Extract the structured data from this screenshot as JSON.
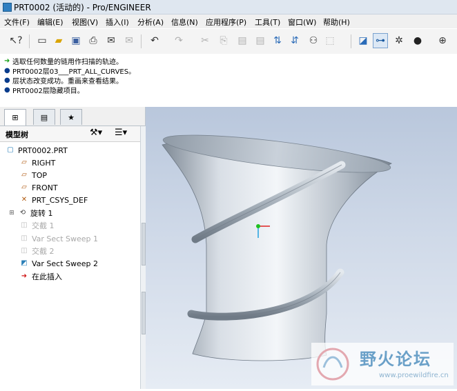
{
  "window": {
    "title": "PRT0002 (活动的) - Pro/ENGINEER"
  },
  "menu": {
    "items": [
      "文件(F)",
      "编辑(E)",
      "视图(V)",
      "插入(I)",
      "分析(A)",
      "信息(N)",
      "应用程序(P)",
      "工具(T)",
      "窗口(W)",
      "帮助(H)"
    ]
  },
  "toolbar": {
    "buttons": [
      {
        "name": "context-help-icon",
        "glyph": "↖?"
      },
      {
        "name": "new-file-icon",
        "glyph": "🗋"
      },
      {
        "name": "open-folder-icon",
        "glyph": "📂"
      },
      {
        "name": "save-icon",
        "glyph": "💾"
      },
      {
        "name": "print-icon",
        "glyph": "🖶"
      },
      {
        "name": "send-mail-icon",
        "glyph": "✉"
      },
      {
        "name": "send-link-icon",
        "glyph": "✉"
      },
      {
        "name": "undo-icon",
        "glyph": "↶"
      },
      {
        "name": "redo-icon",
        "glyph": "↷"
      },
      {
        "name": "cut-icon",
        "glyph": "✂"
      },
      {
        "name": "copy-icon",
        "glyph": "⎘"
      },
      {
        "name": "paste-icon",
        "glyph": "📋"
      },
      {
        "name": "paste-special-icon",
        "glyph": "📋"
      },
      {
        "name": "regenerate-icon",
        "glyph": "⇅"
      },
      {
        "name": "regen-manager-icon",
        "glyph": "⇅"
      },
      {
        "name": "find-icon",
        "glyph": "🔭"
      },
      {
        "name": "select-box-icon",
        "glyph": "⬚"
      },
      {
        "name": "repaint-icon",
        "glyph": "◪"
      },
      {
        "name": "spin-center-icon",
        "glyph": "⊶"
      },
      {
        "name": "orient-mode-icon",
        "glyph": "✲"
      },
      {
        "name": "shading-icon",
        "glyph": "●"
      },
      {
        "name": "zoom-in-icon",
        "glyph": "🔍"
      },
      {
        "name": "zoom-out-icon",
        "glyph": "⊖"
      }
    ]
  },
  "messages": [
    {
      "bullet": "arrow",
      "text": "选取任何数量的链用作扫描的轨迹。"
    },
    {
      "bullet": "dot",
      "text": "PRT0002层03___PRT_ALL_CURVES。"
    },
    {
      "bullet": "dot",
      "text": "层状态改变成功。重画来查看结果。"
    },
    {
      "bullet": "dot",
      "text": "PRT0002层隐藏项目。"
    }
  ],
  "model_tree": {
    "header": "模型树",
    "items": [
      {
        "label": "PRT0002.PRT",
        "icon": "part-icon",
        "dim": false,
        "indent": 0
      },
      {
        "label": "RIGHT",
        "icon": "datum-plane-icon",
        "dim": false,
        "indent": 1
      },
      {
        "label": "TOP",
        "icon": "datum-plane-icon",
        "dim": false,
        "indent": 1
      },
      {
        "label": "FRONT",
        "icon": "datum-plane-icon",
        "dim": false,
        "indent": 1
      },
      {
        "label": "PRT_CSYS_DEF",
        "icon": "csys-icon",
        "dim": false,
        "indent": 1
      },
      {
        "label": "旋转 1",
        "icon": "revolve-icon",
        "dim": false,
        "indent": 1
      },
      {
        "label": "交截 1",
        "icon": "intersect-icon",
        "dim": true,
        "indent": 1
      },
      {
        "label": "Var Sect Sweep 1",
        "icon": "sweep-icon",
        "dim": true,
        "indent": 1
      },
      {
        "label": "交截 2",
        "icon": "intersect-icon",
        "dim": true,
        "indent": 1
      },
      {
        "label": "Var Sect Sweep 2",
        "icon": "sweep-icon",
        "dim": false,
        "indent": 1
      },
      {
        "label": "在此插入",
        "icon": "insert-here-icon",
        "dim": false,
        "indent": 1
      }
    ]
  },
  "watermark": {
    "text": "野火论坛",
    "url": "www.proewildfire.cn"
  }
}
